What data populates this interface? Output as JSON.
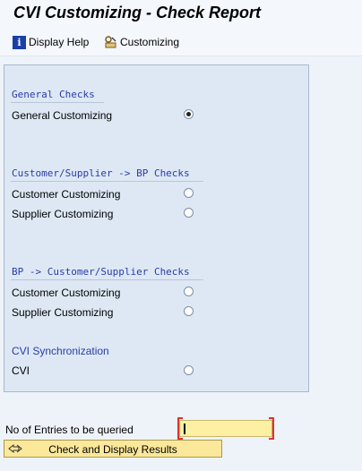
{
  "window": {
    "title": "CVI Customizing - Check Report"
  },
  "toolbar": {
    "display_help": {
      "label": "Display Help",
      "icon": "info-icon"
    },
    "customizing": {
      "label": "Customizing",
      "icon": "customizing-icon"
    }
  },
  "groups": {
    "general": {
      "title": "General Checks",
      "options": [
        "General Customizing"
      ]
    },
    "cust_supp_bp": {
      "title": "Customer/Supplier -> BP Checks",
      "options": [
        "Customer Customizing",
        "Supplier Customizing"
      ]
    },
    "bp_cust_supp": {
      "title": "BP -> Customer/Supplier Checks",
      "options": [
        "Customer Customizing",
        "Supplier Customizing"
      ]
    },
    "cvi_sync": {
      "title": "CVI Synchronization",
      "options": [
        "CVI"
      ]
    }
  },
  "selected_option": "General Customizing",
  "entries": {
    "label": "No of Entries to be queried",
    "value": ""
  },
  "execute": {
    "label": "Check and Display Results",
    "icon": "execute-icon"
  },
  "colors": {
    "group_title": "#2a3ca8",
    "input_bg": "#fdf0a3",
    "button_bg": "#fce89a"
  }
}
